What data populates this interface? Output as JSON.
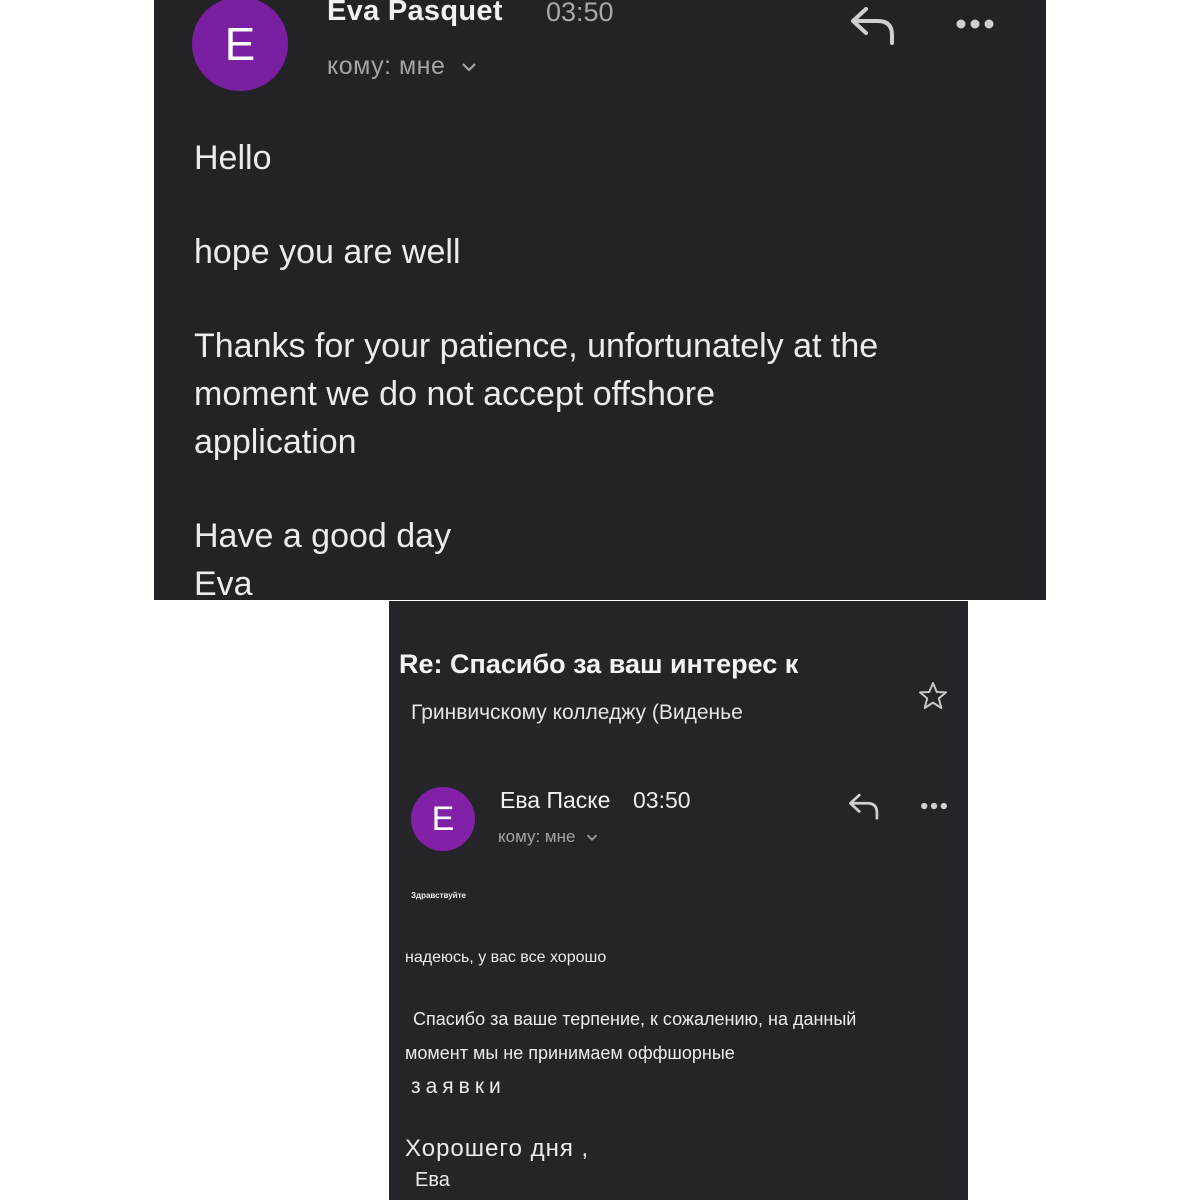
{
  "english_email": {
    "sender_initial": "E",
    "sender_name": "Eva Pasquet",
    "time": "03:50",
    "recipient": "кому: мне",
    "paragraphs": [
      "Hello",
      "hope you are well",
      "Thanks for your patience, unfortunately at the\nmoment we do not accept offshore\napplication",
      "Have a good day\nEva"
    ],
    "icons": [
      "reply-icon",
      "more-options-icon",
      "chevron-down-icon"
    ]
  },
  "russian_email": {
    "subject_line1": "Re: Спасибо за ваш интерес к",
    "subject_line2": "Гринвичскому колледжу (Виденье",
    "sender_initial": "E",
    "sender_name": "Ева Паске",
    "time": "03:50",
    "recipient": "кому: мне",
    "lines": [
      "Здравствуйте",
      "надеюсь, у вас все хорошо",
      "Спасибо за ваше терпение, к сожалению, на данный",
      "момент мы не принимаем оффшорные",
      "заявки",
      "Хорошего дня ,",
      "Ева"
    ],
    "icons": [
      "star-icon",
      "reply-icon",
      "more-options-icon",
      "chevron-down-icon"
    ]
  },
  "colors": {
    "background": "#ffffff",
    "panel": "#232226",
    "avatar": "#7b1fa2",
    "text": "#ececec",
    "muted": "#a8a8ac"
  }
}
